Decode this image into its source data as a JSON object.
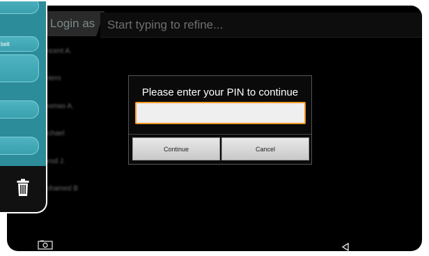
{
  "login_bar": {
    "tab_label": "Login as",
    "search_placeholder": "Start typing to refine..."
  },
  "users": [
    "Vincent A.",
    "Antero",
    "Thomas A.",
    "Michael",
    "Jarod J.",
    "Mohamed B"
  ],
  "side_panel": {
    "items": [
      {
        "label": ""
      },
      {
        "label": "belt"
      },
      {
        "label": ""
      },
      {
        "label": ""
      },
      {
        "label": ""
      }
    ],
    "trash_icon": "trash-icon"
  },
  "pin_dialog": {
    "title": "Please enter your PIN to continue",
    "pin_value": "",
    "continue_label": "Continue",
    "cancel_label": "Cancel"
  },
  "nav_bar": {
    "left_icon": "camera-icon",
    "right_icon": "back-icon"
  },
  "colors": {
    "accent": "#f39a28",
    "panel": "#2c8c9a",
    "panel_button": "#4fb3c1",
    "background": "#000000"
  }
}
